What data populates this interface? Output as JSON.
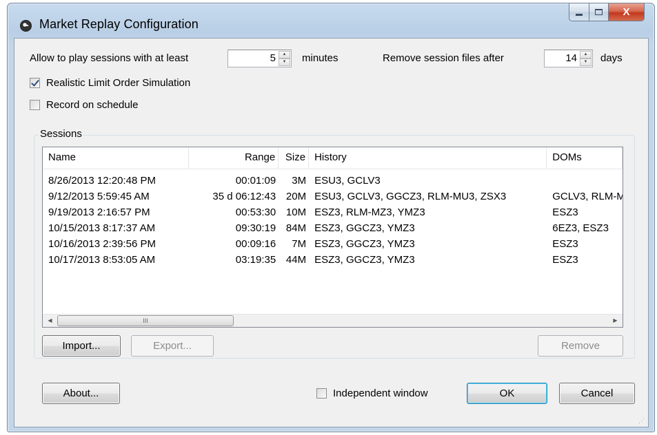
{
  "window": {
    "title": "Market Replay Configuration",
    "close_glyph": "X"
  },
  "settings": {
    "min_play_label": "Allow to play sessions with at least",
    "min_play_value": "5",
    "min_play_unit": "minutes",
    "remove_after_label": "Remove session files after",
    "remove_after_value": "14",
    "remove_after_unit": "days",
    "realistic_label": "Realistic Limit Order Simulation",
    "realistic_checked": true,
    "record_label": "Record on schedule",
    "record_checked": false
  },
  "sessions": {
    "group_label": "Sessions",
    "columns": [
      "Name",
      "Range",
      "Size",
      "History",
      "DOMs"
    ],
    "rows": [
      {
        "name": "8/26/2013 12:20:48 PM",
        "range": "00:01:09",
        "size": "3M",
        "history": "ESU3, GCLV3",
        "doms": ""
      },
      {
        "name": "9/12/2013 5:59:45 AM",
        "range": "35 d 06:12:43",
        "size": "20M",
        "history": "ESU3, GCLV3, GGCZ3, RLM-MU3, ZSX3",
        "doms": "GCLV3, RLM-M"
      },
      {
        "name": "9/19/2013 2:16:57 PM",
        "range": "00:53:30",
        "size": "10M",
        "history": "ESZ3, RLM-MZ3, YMZ3",
        "doms": "ESZ3"
      },
      {
        "name": "10/15/2013 8:17:37 AM",
        "range": "09:30:19",
        "size": "84M",
        "history": "ESZ3, GGCZ3, YMZ3",
        "doms": "6EZ3, ESZ3"
      },
      {
        "name": "10/16/2013 2:39:56 PM",
        "range": "00:09:16",
        "size": "7M",
        "history": "ESZ3, GGCZ3, YMZ3",
        "doms": "ESZ3"
      },
      {
        "name": "10/17/2013 8:53:05 AM",
        "range": "03:19:35",
        "size": "44M",
        "history": "ESZ3, GGCZ3, YMZ3",
        "doms": "ESZ3"
      }
    ],
    "scroll_thumb_glyph": "III",
    "import_label": "Import...",
    "export_label": "Export...",
    "remove_label": "Remove"
  },
  "footer": {
    "about_label": "About...",
    "independent_label": "Independent window",
    "independent_checked": false,
    "ok_label": "OK",
    "cancel_label": "Cancel"
  }
}
